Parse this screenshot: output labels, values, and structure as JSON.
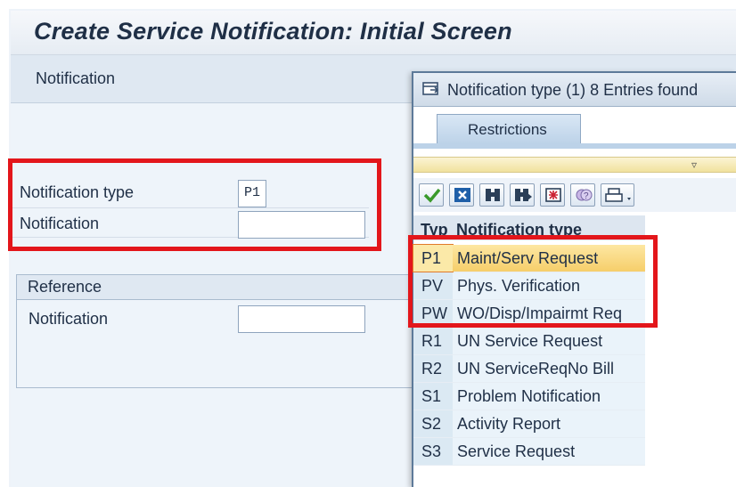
{
  "screen": {
    "title": "Create Service Notification: Initial Screen",
    "menu_label": "Notification"
  },
  "form": {
    "notification_type_label": "Notification type",
    "notification_type_value": "P1",
    "notification_label": "Notification",
    "notification_value": ""
  },
  "reference": {
    "group_title": "Reference",
    "notification_label": "Notification",
    "notification_value": ""
  },
  "popup": {
    "title": "Notification type (1)   8 Entries found",
    "tab_restrictions": "Restrictions",
    "toolbar_icons": [
      "check-icon",
      "cancel-icon",
      "find-icon",
      "find-next-icon",
      "select-icon",
      "help-icon",
      "print-icon"
    ],
    "list": {
      "col_typ": "Typ",
      "col_name": "Notification type",
      "rows": [
        {
          "code": "P1",
          "name": "Maint/Serv Request"
        },
        {
          "code": "PV",
          "name": "Phys. Verification"
        },
        {
          "code": "PW",
          "name": "WO/Disp/Impairmt Req"
        },
        {
          "code": "R1",
          "name": "UN Service Request"
        },
        {
          "code": "R2",
          "name": "UN ServiceReqNo Bill"
        },
        {
          "code": "S1",
          "name": "Problem Notification"
        },
        {
          "code": "S2",
          "name": "Activity Report"
        },
        {
          "code": "S3",
          "name": "Service Request"
        }
      ]
    }
  },
  "colors": {
    "highlight": "#e3161b",
    "selected_row": "#f6ce6a"
  }
}
